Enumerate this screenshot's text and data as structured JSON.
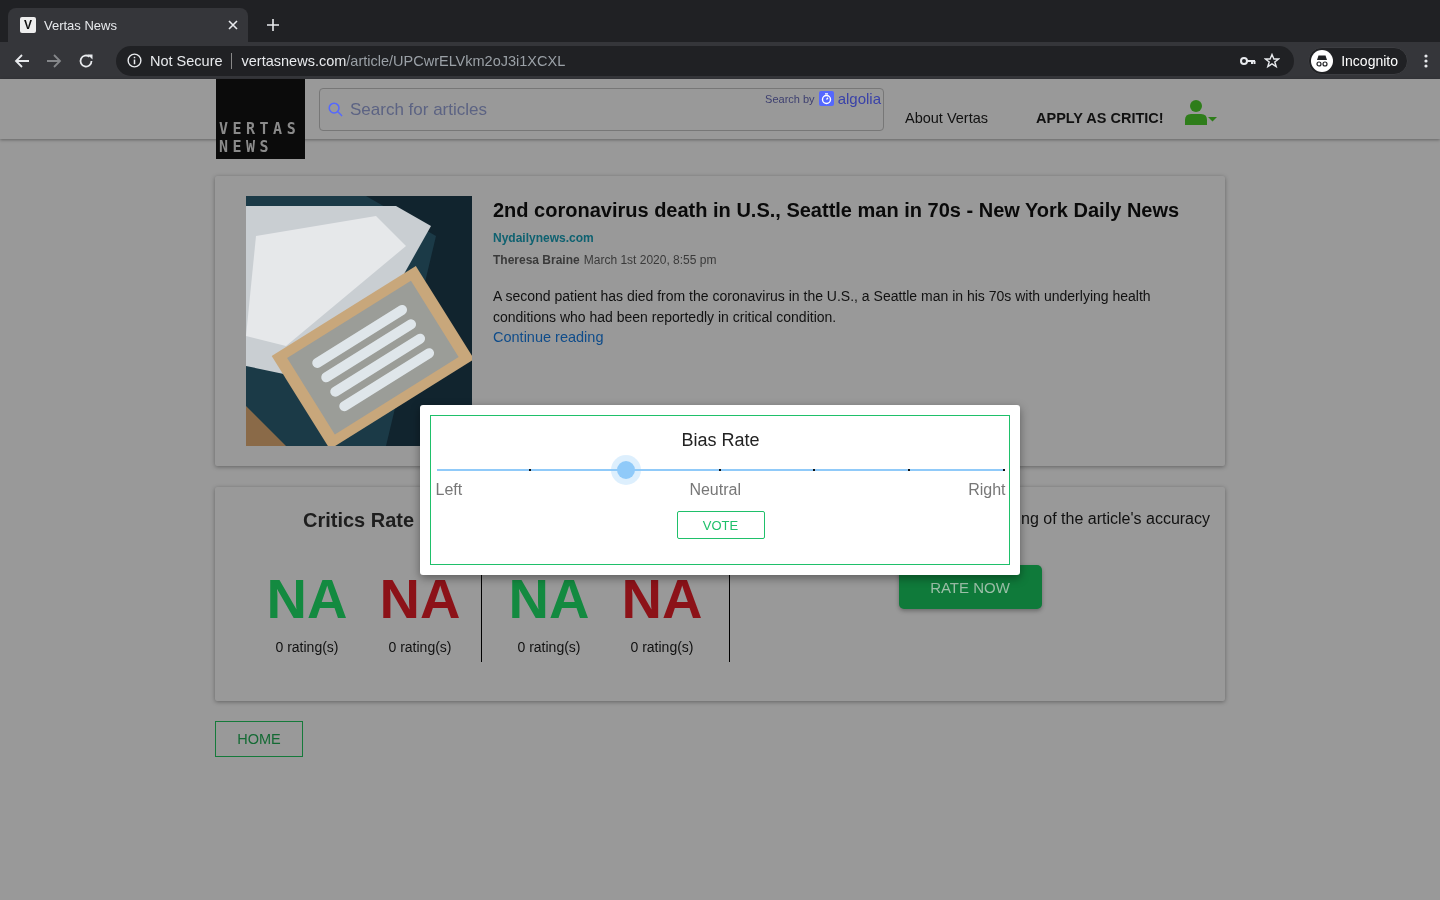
{
  "browser": {
    "tab": {
      "favicon": "V",
      "title": "Vertas News",
      "selected": true
    },
    "security": "Not Secure",
    "url_host": "vertasnews.com",
    "url_path": "/article/UPCwrELVkm2oJ3i1XCXL",
    "profile": "Incognito"
  },
  "header": {
    "logo": [
      "VERTAS",
      "NEWS"
    ],
    "search": {
      "placeholder": "Search for articles",
      "search_by": "Search by",
      "provider": "algolia"
    },
    "nav": [
      "About Vertas",
      "APPLY AS CRITIC!"
    ]
  },
  "article": {
    "title": "2nd coronavirus death in U.S., Seattle man in 70s - New York Daily News",
    "source": "Nydailynews.com",
    "author": "Theresa Braine",
    "date": "March 1st 2020, 8:55 pm",
    "summary": "A second patient has died from the coronavirus in the U.S., a Seattle man in his 70s with underlying health conditions who had been reportedly in critical condition.",
    "link": "Continue reading"
  },
  "ratings": {
    "groups": [
      {
        "heading": "Critics Rate",
        "scores": [
          {
            "value": "NA",
            "color": "#138a40",
            "count": "0 rating(s)"
          },
          {
            "value": "NA",
            "color": "#8c1218",
            "count": "0 rating(s)"
          }
        ]
      },
      {
        "scores": [
          {
            "value": "NA",
            "color": "#138a40",
            "count": "0 rating(s)"
          },
          {
            "value": "NA",
            "color": "#8c1218",
            "count": "0 rating(s)"
          }
        ]
      }
    ],
    "prompt": "ng of the article's accuracy",
    "button": "RATE NOW"
  },
  "home_button": "HOME",
  "modal": {
    "title": "Bias Rate",
    "slider": {
      "level": 0.333,
      "labels": [
        "Left",
        "Neutral",
        "Right"
      ]
    },
    "button": "VOTE"
  }
}
